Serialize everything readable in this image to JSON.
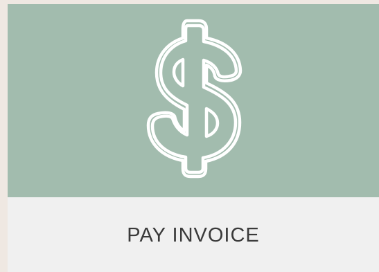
{
  "card": {
    "label": "PAY INVOICE",
    "icon": "dollar-sign-icon",
    "colors": {
      "hero_background": "#a2bcae",
      "footer_background": "#f0f0f0",
      "page_background": "#efe8e2",
      "icon_stroke": "#ffffff",
      "label_text": "#3a3a3a"
    }
  }
}
